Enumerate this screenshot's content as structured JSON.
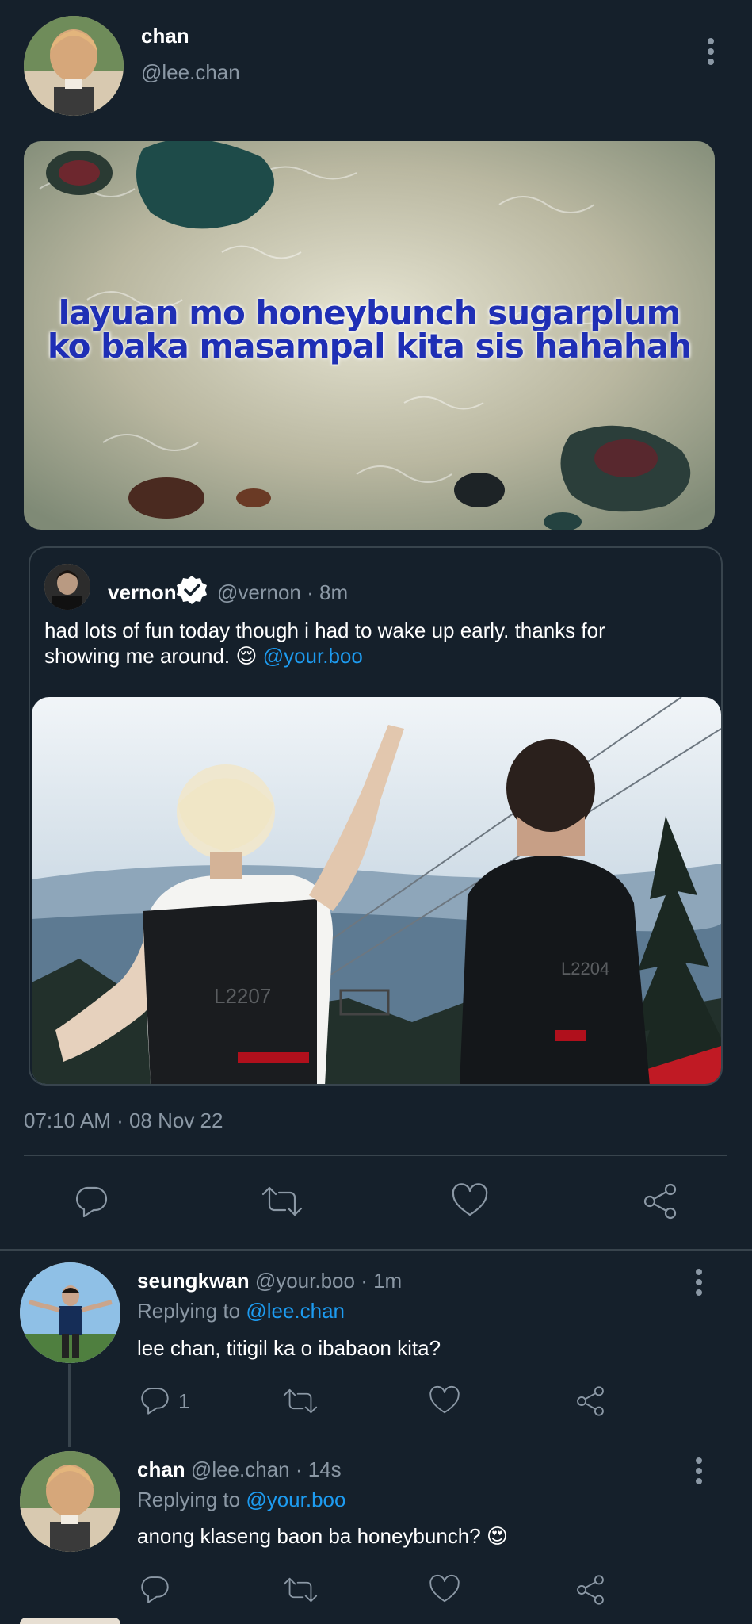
{
  "main_tweet": {
    "author_name": "chan",
    "author_handle": "@lee.chan",
    "meme_text_line1": "layuan mo honeybunch sugarplum",
    "meme_text_line2": "ko baka masampal kita sis hahahah",
    "timestamp": "07:10 AM · 08 Nov 22"
  },
  "quoted_tweet": {
    "author_name": "vernon",
    "author_handle": "@vernon",
    "time": "· 8m",
    "text_line1": "had lots of fun today though i had to wake up early. thanks for",
    "text_line2": "showing me around. 😌",
    "mention": "@your.boo",
    "vest_label_left": "L2207",
    "vest_label_right": "L2204"
  },
  "actions": {
    "reply": "reply-icon",
    "retweet": "retweet-icon",
    "like": "heart-icon",
    "share": "share-icon"
  },
  "replies": [
    {
      "author_name": "seungkwan",
      "author_handle": "@your.boo",
      "time": "· 1m",
      "replying_prefix": "Replying to",
      "replying_to": "@lee.chan",
      "text": "lee chan, titigil ka o ibabaon kita?",
      "reply_count": "1"
    },
    {
      "author_name": "chan",
      "author_handle": "@lee.chan",
      "time": "· 14s",
      "replying_prefix": "Replying to",
      "replying_to": "@your.boo",
      "text": "anong klaseng baon ba honeybunch? 😍",
      "reply_count": ""
    }
  ],
  "colors": {
    "background": "#15202b",
    "accent": "#1d9bf0",
    "muted": "#8b98a5",
    "border": "#38444d"
  }
}
